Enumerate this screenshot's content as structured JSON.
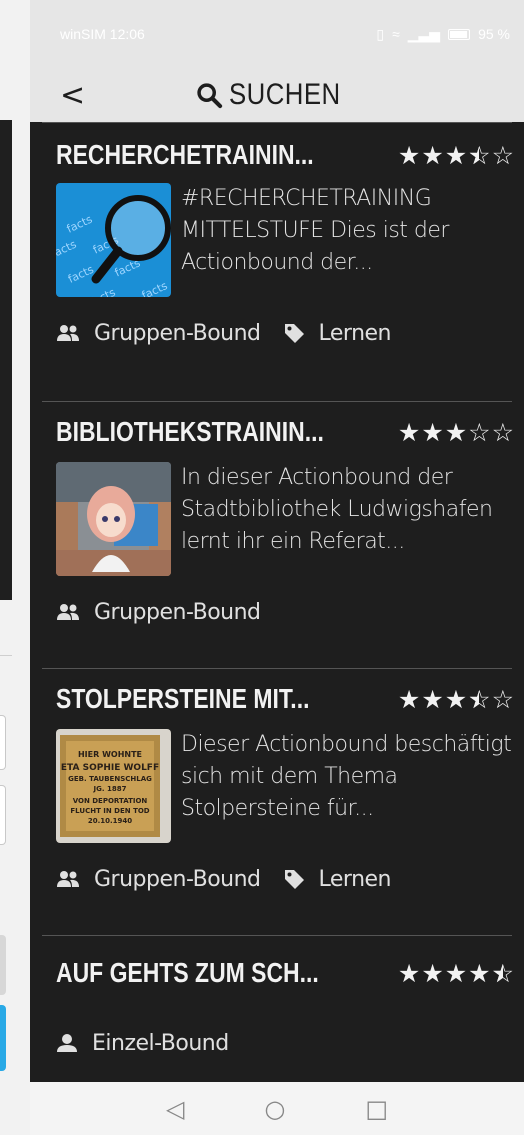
{
  "status_bar": {
    "carrier_time": "winSIM 12:06",
    "battery": "95 %"
  },
  "header": {
    "back_label": "<",
    "title": "SUCHEN"
  },
  "results": [
    {
      "title": "RECHERCHETRAININ...",
      "rating": 3.5,
      "description": "#RECHERCHETRAINING MITTELSTUFE Dies ist der Actionbound der...",
      "tags": [
        "Gruppen-Bound",
        "Lernen"
      ]
    },
    {
      "title": "BIBLIOTHEKSTRAININ...",
      "rating": 3,
      "description": "In dieser Actionbound der Stadtbibliothek Ludwigshafen lernt ihr ein Referat...",
      "tags": [
        "Gruppen-Bound"
      ]
    },
    {
      "title": "STOLPERSTEINE MIT...",
      "rating": 3.5,
      "description": "Dieser Actionbound beschäftigt sich mit dem Thema Stolpersteine für...",
      "tags": [
        "Gruppen-Bound",
        "Lernen"
      ]
    },
    {
      "title": "AUF GEHTS ZUM SCH...",
      "rating": 4.5,
      "description": "",
      "tags": [
        "Einzel-Bound"
      ]
    }
  ],
  "thumb_text": {
    "facts": "facts",
    "stone_lines": [
      "HIER WOHNTE",
      "ETA SOPHIE WOLFF",
      "GEB. TAUBENSCHLAG",
      "JG. 1887",
      "VON DEPORTATION",
      "FLUCHT IN DEN TOD",
      "20.10.1940"
    ]
  },
  "nav": {
    "back": "◁",
    "home": "○",
    "recents": "□"
  },
  "colors": {
    "background": "#1e1e1e",
    "header": "#e6e6e6",
    "text": "#f2f2f2"
  }
}
